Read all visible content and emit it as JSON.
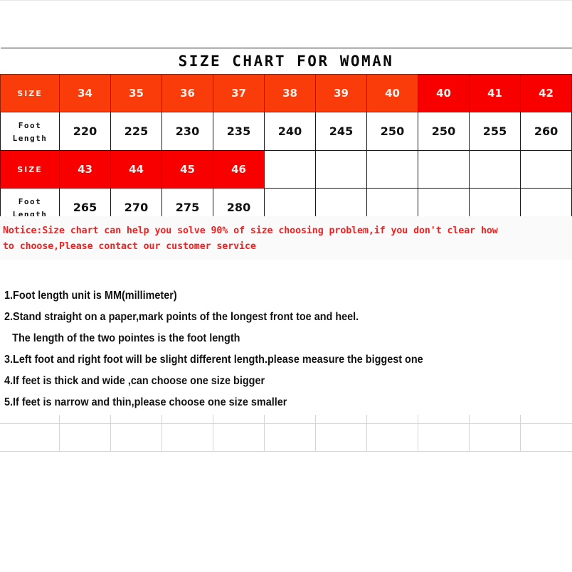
{
  "title": "SIZE CHART FOR WOMAN",
  "table": {
    "row_labels": {
      "size": "SIZE",
      "foot_length": "Foot Length"
    },
    "group_1": {
      "header_color_primary": "#FA3C0A",
      "header_color_secondary": "#F80000",
      "sizes": [
        "34",
        "35",
        "36",
        "37",
        "38",
        "39",
        "40",
        "40",
        "41",
        "42"
      ],
      "size_cell_colors": [
        "orange",
        "orange",
        "orange",
        "orange",
        "orange",
        "orange",
        "orange",
        "red",
        "red",
        "red"
      ],
      "foot_lengths": [
        "220",
        "225",
        "230",
        "235",
        "240",
        "245",
        "250",
        "250",
        "255",
        "260"
      ]
    },
    "group_2": {
      "header_color": "#F80000",
      "sizes": [
        "43",
        "44",
        "45",
        "46",
        "",
        "",
        "",
        "",
        "",
        ""
      ],
      "size_cell_colors": [
        "red",
        "red",
        "red",
        "red",
        "blank",
        "blank",
        "blank",
        "blank",
        "blank",
        "blank"
      ],
      "foot_lengths": [
        "265",
        "270",
        "275",
        "280",
        "",
        "",
        "",
        "",
        "",
        ""
      ]
    }
  },
  "notice": {
    "color": "#F42020",
    "line1": "Notice:Size chart can help you solve 90% of size choosing problem,if you don't clear how",
    "line2": "to choose,Please contact our customer service"
  },
  "instructions": [
    "1.Foot length unit is MM(millimeter)",
    "2.Stand straight on a paper,mark points of the longest front toe and heel.",
    "The length of the two pointes is the foot length",
    "3.Left foot and right foot will be slight different length.please measure the biggest one",
    "4.If feet is thick and wide ,can choose one size bigger",
    "5.If feet is narrow and thin,please choose one size smaller"
  ],
  "bottom_grid": {
    "columns": 11,
    "rows": 2
  }
}
